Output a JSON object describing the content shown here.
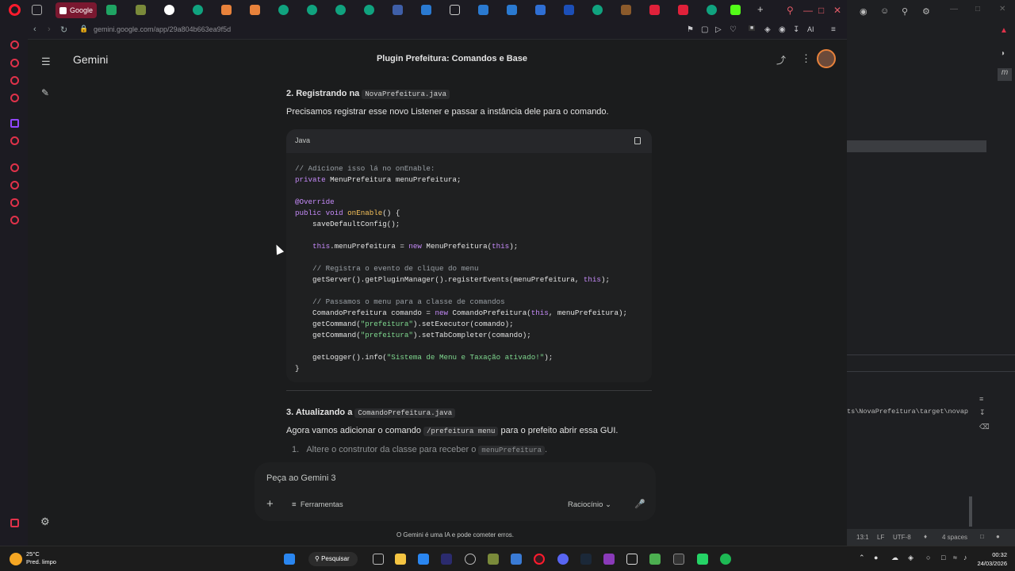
{
  "browser": {
    "active_tab_label": "Google",
    "url": "gemini.google.com/app/29a804b663ea9f5d",
    "ai_label": "AI"
  },
  "gemini": {
    "brand": "Gemini",
    "chat_title": "Plugin Prefeitura: Comandos e Base",
    "section2_heading": "2. Registrando na",
    "section2_file": "NovaPrefeitura.java",
    "section2_text": "Precisamos registrar esse novo Listener e passar a instância dele para o comando.",
    "code_lang": "Java",
    "section3_heading": "3. Atualizando a",
    "section3_file": "ComandoPrefeitura.java",
    "section3_text_a": "Agora vamos adicionar o comando",
    "section3_cmd": "/prefeitura menu",
    "section3_text_b": "para o prefeito abrir essa GUI.",
    "list_item_1_text": "Altere o construtor da classe para receber o",
    "list_item_1_code": "menuPrefeitura",
    "input_placeholder": "Peça ao Gemini 3",
    "tools_label": "Ferramentas",
    "model_label": "Raciocínio",
    "footer_note": "O Gemini é uma IA e pode cometer erros."
  },
  "ide": {
    "console_path": "ts\\NovaPrefeitura\\target\\novap",
    "status": {
      "position": "13:1",
      "line_sep": "LF",
      "encoding": "UTF-8",
      "indent": "4 spaces"
    }
  },
  "taskbar": {
    "weather_temp": "25°C",
    "weather_desc": "Pred. limpo",
    "search_label": "Pesquisar",
    "time": "00:32",
    "date": "24/03/2026"
  },
  "colors": {
    "accent_red": "#ff1b2d",
    "keyword": "#c58af9",
    "string": "#7fd88f",
    "method": "#f5c15a",
    "comment": "#9aa0a6"
  }
}
